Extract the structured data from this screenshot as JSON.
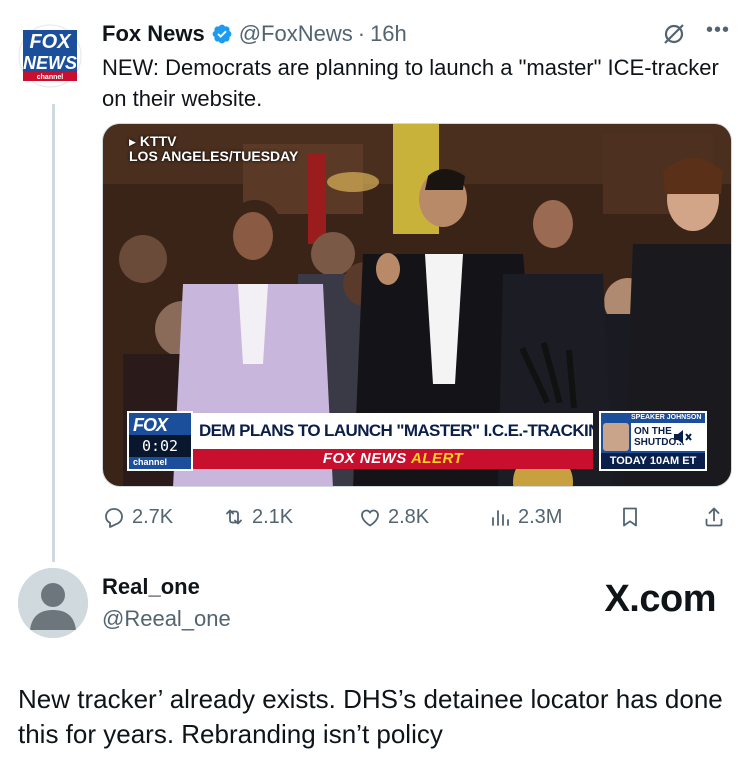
{
  "tweet": {
    "display_name": "Fox News",
    "handle": "@FoxNews",
    "separator": "·",
    "time": "16h",
    "text": "NEW: Democrats are planning to launch a \"master\" ICE-tracker on their website.",
    "avatar": {
      "logo_top": "FOX",
      "logo_bottom": "NEWS",
      "logo_sub": "channel"
    },
    "icons": {
      "verified": "verified-badge-icon",
      "grok": "grok-icon",
      "more": "more-icon"
    }
  },
  "video": {
    "station": "KTTV",
    "location": "LOS ANGELES/TUESDAY",
    "bug_logo": "FOX",
    "timer": "0:02",
    "bug_channel": "channel",
    "headline": "DEM PLANS TO LAUNCH \"MASTER\" I.C.E.-TRACKING SITE",
    "alert_prefix": "FOX NEWS",
    "alert_suffix": "ALERT",
    "promo": {
      "who": "SPEAKER JOHNSON",
      "show": "ON THE SHUTDO...",
      "when": "TODAY 10AM ET"
    },
    "icons": {
      "mute": "mute-icon"
    }
  },
  "actions": {
    "replies": "2.7K",
    "reposts": "2.1K",
    "likes": "2.8K",
    "views": "2.3M",
    "icons": [
      "reply-icon",
      "repost-icon",
      "like-icon",
      "views-icon",
      "bookmark-icon",
      "share-icon"
    ]
  },
  "reply": {
    "display_name": "Real_one",
    "handle": "@Reeal_one",
    "brand": "X.com",
    "text": "New tracker’ already exists. DHS’s detainee locator has done this for years. Rebranding isn’t policy"
  },
  "colors": {
    "text_primary": "#0f1419",
    "text_secondary": "#536471",
    "verified_blue": "#1d9bf0",
    "fox_blue": "#1b4f9c",
    "fox_red": "#c8102e"
  }
}
